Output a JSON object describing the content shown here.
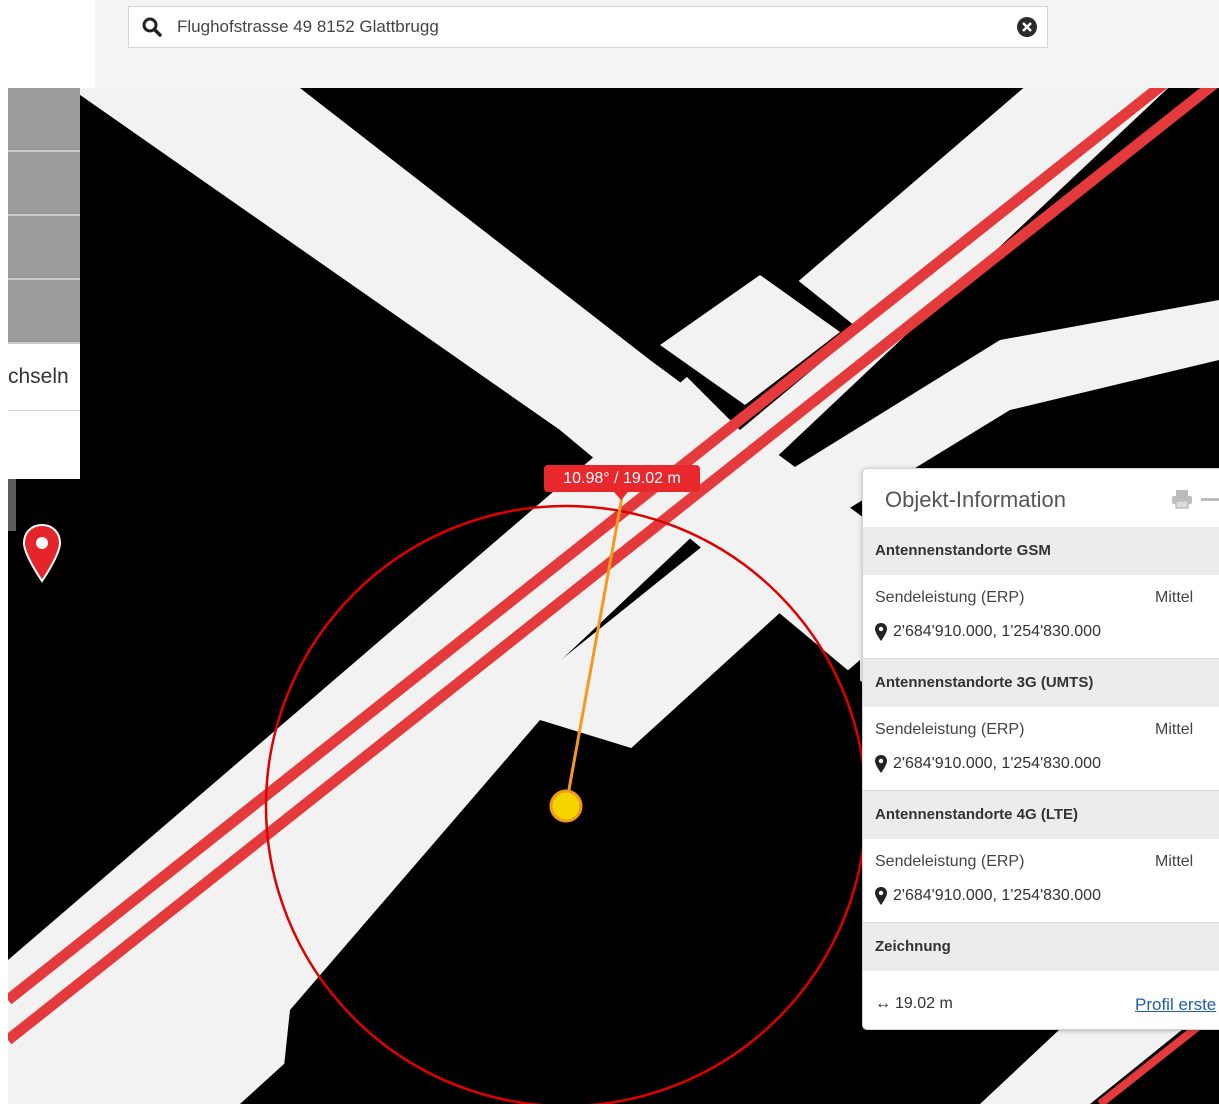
{
  "search": {
    "value": "Flughofstrasse 49 8152 Glattbrugg",
    "icon": "search-icon",
    "clear_icon": "close-circle-icon"
  },
  "left_menu": {
    "partial_label": "chseln"
  },
  "map": {
    "measure_label": "10.98° / 19.02 m",
    "colors": {
      "rail": "#e43a3c",
      "circle": "#e00000",
      "radius_line": "#f39a1c",
      "center_point": "#f5d400"
    }
  },
  "info_panel": {
    "title": "Objekt-Information",
    "layers": [
      {
        "name": "Antennenstandorte GSM",
        "attribute": "Sendeleistung (ERP)",
        "value": "Mittel",
        "coordinates": "2'684'910.000, 1'254'830.000"
      },
      {
        "name": "Antennenstandorte 3G (UMTS)",
        "attribute": "Sendeleistung (ERP)",
        "value": "Mittel",
        "coordinates": "2'684'910.000, 1'254'830.000"
      },
      {
        "name": "Antennenstandorte 4G (LTE)",
        "attribute": "Sendeleistung (ERP)",
        "value": "Mittel",
        "coordinates": "2'684'910.000, 1'254'830.000"
      }
    ],
    "drawing": {
      "name": "Zeichnung",
      "length": "19.02 m",
      "profile_link": "Profil erste"
    }
  }
}
